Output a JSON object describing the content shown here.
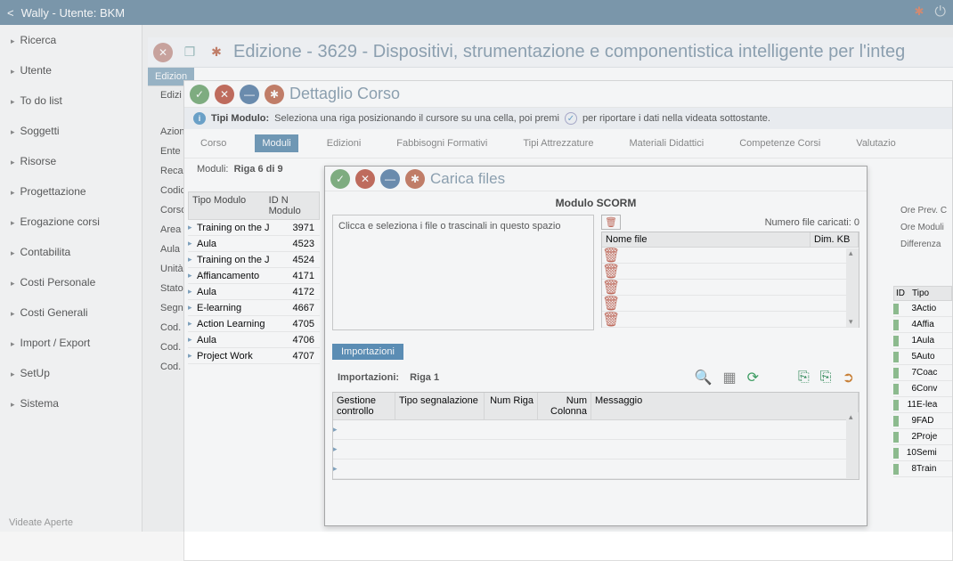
{
  "titlebar": {
    "app": "Wally - Utente: BKM"
  },
  "sidebar": {
    "items": [
      "Ricerca",
      "Utente",
      "To do list",
      "Soggetti",
      "Risorse",
      "Progettazione",
      "Erogazione corsi",
      "Contabilita",
      "Costi Personale",
      "Costi Generali",
      "Import / Export",
      "SetUp",
      "Sistema"
    ],
    "footer": "Videate Aperte"
  },
  "edizione": {
    "title": "Edizione - 3629 - Dispositivi, strumentazione e componentistica intelligente per l'integ",
    "subtabs": [
      "Edizion",
      "Edizi"
    ],
    "fields": [
      "Azione F",
      "Ente Co",
      "Recapito",
      "Codice C",
      "Corso",
      "Area Te",
      "Aula",
      "Unità Or",
      "Stato",
      "Segnala",
      "Cod. Co",
      "Cod. Tu",
      "Cod. Tu"
    ]
  },
  "dettaglio": {
    "title": "Dettaglio Corso",
    "info_label": "Tipi Modulo:",
    "info_text_a": "Seleziona una riga posizionando il cursore su una cella, poi premi",
    "info_text_b": "per riportare i dati nella videata sottostante.",
    "tabs": [
      "Corso",
      "Moduli",
      "Edizioni",
      "Fabbisogni Formativi",
      "Tipi Attrezzature",
      "Materiali Didattici",
      "Competenze Corsi",
      "Valutazio"
    ],
    "active_tab": 1,
    "moduli_label": "Moduli:",
    "moduli_row": "Riga 6 di 9",
    "moduli_th": [
      "Tipo Modulo",
      "ID N Modulo"
    ],
    "moduli_rows": [
      {
        "tipo": "Training on the J",
        "id": "3971"
      },
      {
        "tipo": "Aula",
        "id": "4523"
      },
      {
        "tipo": "Training on the J",
        "id": "4524"
      },
      {
        "tipo": "Affiancamento",
        "id": "4171"
      },
      {
        "tipo": "Aula",
        "id": "4172"
      },
      {
        "tipo": "E-learning",
        "id": "4667"
      },
      {
        "tipo": "Action Learning",
        "id": "4705"
      },
      {
        "tipo": "Aula",
        "id": "4706"
      },
      {
        "tipo": "Project Work",
        "id": "4707"
      }
    ],
    "right_labels": [
      "Ore Prev. C",
      "Ore Moduli",
      "Differenza"
    ],
    "right_th": [
      "ID",
      "Tipo"
    ],
    "right_rows": [
      {
        "id": "3",
        "t": "Actio"
      },
      {
        "id": "4",
        "t": "Affia"
      },
      {
        "id": "1",
        "t": "Aula"
      },
      {
        "id": "5",
        "t": "Auto"
      },
      {
        "id": "7",
        "t": "Coac"
      },
      {
        "id": "6",
        "t": "Conv"
      },
      {
        "id": "11",
        "t": "E-lea"
      },
      {
        "id": "9",
        "t": "FAD"
      },
      {
        "id": "2",
        "t": "Proje"
      },
      {
        "id": "10",
        "t": "Semi"
      },
      {
        "id": "8",
        "t": "Train"
      }
    ]
  },
  "carica": {
    "title": "Carica files",
    "subtitle": "Modulo SCORM",
    "drop_text": "Clicca e seleziona i file o trascinali in questo spazio",
    "count_label": "Numero file caricati:",
    "count_val": "0",
    "files_th": [
      "Nome file",
      "Dim. KB"
    ],
    "imp_tab": "Importazioni",
    "imp_label": "Importazioni:",
    "imp_row": "Riga 1",
    "grid_th": [
      "Gestione controllo",
      "Tipo segnalazione",
      "Num Riga",
      "Num Colonna",
      "Messaggio"
    ]
  }
}
